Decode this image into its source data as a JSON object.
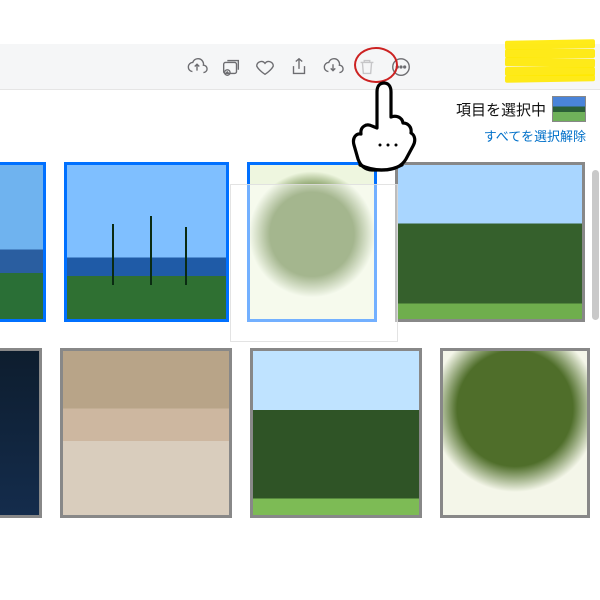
{
  "toolbar": {
    "cloud_upload": "iCloudにアップロード",
    "add_to": "追加",
    "favorite": "お気に入り",
    "share": "共有",
    "cloud_download": "iCloudからダウンロード",
    "trash": "削除",
    "more": "その他"
  },
  "selection": {
    "status_text": "項目を選択中",
    "deselect_all": "すべてを選択解除"
  },
  "photos_row1": [
    {
      "id": "ph1",
      "alt": "海と空",
      "selected": true
    },
    {
      "id": "ph2",
      "alt": "ヤシの木と海",
      "selected": true
    },
    {
      "id": "ph3",
      "alt": "木のクローズアップ",
      "selected": true
    },
    {
      "id": "ph4",
      "alt": "緑の丘",
      "selected": false
    }
  ],
  "photos_row2": [
    {
      "id": "ph5",
      "alt": "夜景",
      "selected": false
    },
    {
      "id": "ph6",
      "alt": "虹の空",
      "selected": false
    },
    {
      "id": "ph7",
      "alt": "緑の丘2",
      "selected": false
    },
    {
      "id": "ph8",
      "alt": "木の樹冠",
      "selected": false
    }
  ],
  "annotation": {
    "highlight": "yellow-highlight",
    "circle_target": "cloud_download",
    "pointer": "hand-cursor"
  }
}
